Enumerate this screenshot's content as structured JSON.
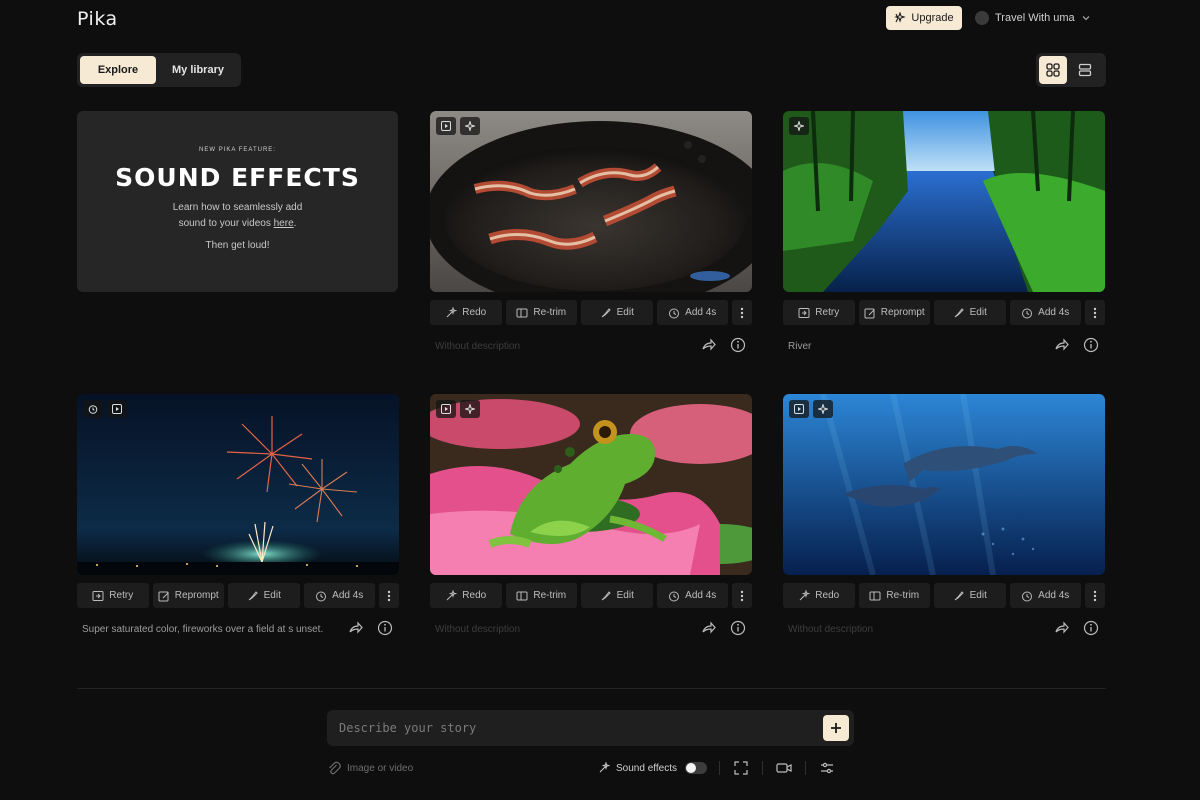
{
  "app": {
    "logo": "Pika"
  },
  "header": {
    "upgrade_label": "Upgrade",
    "user_name": "Travel With uma"
  },
  "tabs": [
    {
      "label": "Explore",
      "active": true
    },
    {
      "label": "My library",
      "active": false
    }
  ],
  "view_modes": [
    {
      "icon": "grid-icon",
      "active": true
    },
    {
      "icon": "list-icon",
      "active": false
    }
  ],
  "promo": {
    "kicker": "NEW PIKA FEATURE:",
    "title": "SOUND EFFECTS",
    "body_line1": "Learn how to seamlessly add",
    "body_line2_prefix": "sound to your videos ",
    "body_link": "here",
    "body_line2_suffix": ".",
    "tail": "Then get loud!"
  },
  "cards": [
    {
      "scene": "bacon",
      "badges": [
        "play-box-icon",
        "sparkle-icon"
      ],
      "actions": [
        {
          "icon": "magic-icon",
          "label": "Redo"
        },
        {
          "icon": "trim-icon",
          "label": "Re-trim"
        },
        {
          "icon": "brush-icon",
          "label": "Edit"
        },
        {
          "icon": "timer-icon",
          "label": "Add 4s"
        }
      ],
      "description": "Without description",
      "has_description": false
    },
    {
      "scene": "river",
      "badges": [
        "sparkle-icon"
      ],
      "actions": [
        {
          "icon": "retry-icon",
          "label": "Retry"
        },
        {
          "icon": "reprompt-icon",
          "label": "Reprompt"
        },
        {
          "icon": "brush-icon",
          "label": "Edit"
        },
        {
          "icon": "timer-icon",
          "label": "Add 4s"
        }
      ],
      "description": "River",
      "has_description": true
    },
    {
      "scene": "fireworks",
      "badges": [
        "timer-icon",
        "play-box-icon"
      ],
      "actions": [
        {
          "icon": "retry-icon",
          "label": "Retry"
        },
        {
          "icon": "reprompt-icon",
          "label": "Reprompt"
        },
        {
          "icon": "brush-icon",
          "label": "Edit"
        },
        {
          "icon": "timer-icon",
          "label": "Add 4s"
        }
      ],
      "description": "Super saturated color, fireworks over a field at s unset.",
      "has_description": true
    },
    {
      "scene": "frog",
      "badges": [
        "play-box-icon",
        "sparkle-icon"
      ],
      "actions": [
        {
          "icon": "magic-icon",
          "label": "Redo"
        },
        {
          "icon": "trim-icon",
          "label": "Re-trim"
        },
        {
          "icon": "brush-icon",
          "label": "Edit"
        },
        {
          "icon": "timer-icon",
          "label": "Add 4s"
        }
      ],
      "description": "Without description",
      "has_description": false
    },
    {
      "scene": "dolphins",
      "badges": [
        "play-box-icon",
        "sparkle-icon"
      ],
      "actions": [
        {
          "icon": "magic-icon",
          "label": "Redo"
        },
        {
          "icon": "trim-icon",
          "label": "Re-trim"
        },
        {
          "icon": "brush-icon",
          "label": "Edit"
        },
        {
          "icon": "timer-icon",
          "label": "Add 4s"
        }
      ],
      "description": "Without description",
      "has_description": false
    }
  ],
  "prompt": {
    "placeholder": "Describe your story",
    "attach_label": "Image or video",
    "sound_effects_label": "Sound effects",
    "sound_effects_on": false
  },
  "colors": {
    "background": "#0e0e0e",
    "accent": "#f6ead4",
    "surface": "#222222"
  }
}
